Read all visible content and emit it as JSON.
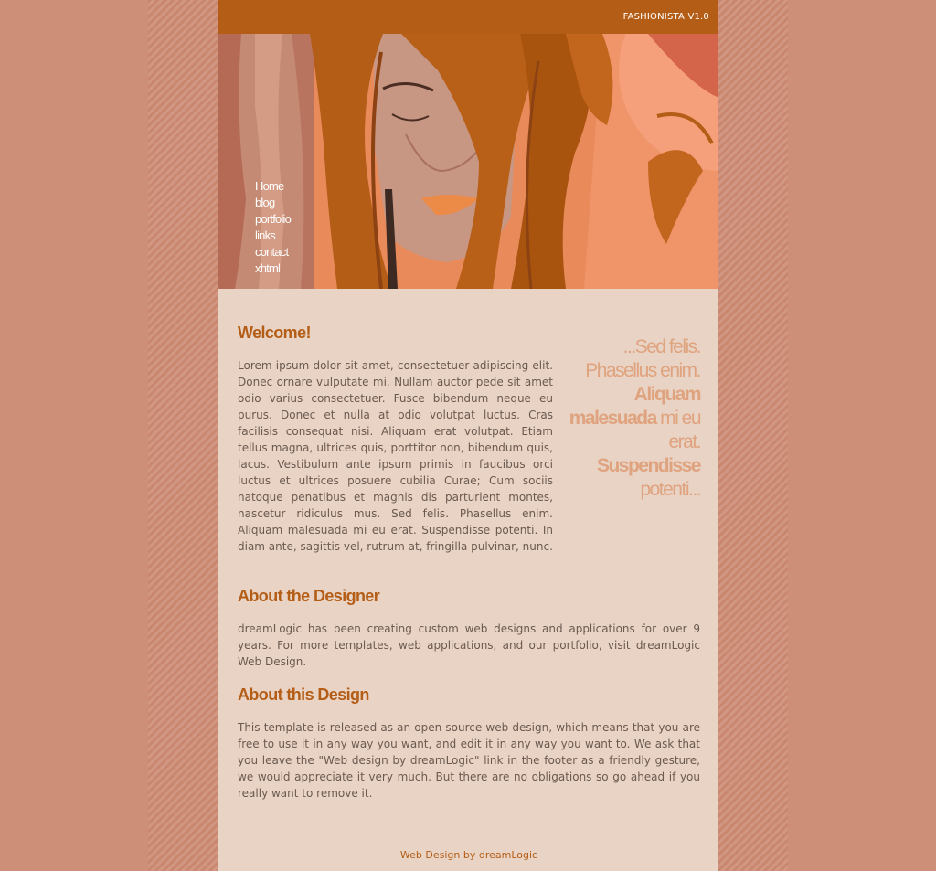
{
  "site": {
    "title": "FASHIONISTA V1.0"
  },
  "nav": {
    "items": [
      "Home",
      "blog",
      "portfolio",
      "links",
      "contact",
      "xhtml"
    ]
  },
  "welcome": {
    "heading": "Welcome!",
    "body": "Lorem ipsum dolor sit amet, consectetuer adipiscing elit. Donec ornare vulputate mi. Nullam auctor pede sit amet odio varius consectetuer. Fusce bibendum neque eu purus. Donec et nulla at odio volutpat luctus. Cras facilisis consequat nisi. Aliquam erat volutpat. Etiam tellus magna, ultrices quis, porttitor non, bibendum quis, lacus. Vestibulum ante ipsum primis in faucibus orci luctus et ultrices posuere cubilia Curae; Cum sociis natoque penatibus et magnis dis parturient montes, nascetur ridiculus mus. Sed felis. Phasellus enim. Aliquam malesuada mi eu erat. Suspendisse potenti. In diam ante, sagittis vel, rutrum at, fringilla pulvinar, nunc."
  },
  "pullquote": {
    "part1": "...Sed felis. Phasellus enim. ",
    "bold1": "Aliquam malesuada",
    "part2": " mi eu erat. ",
    "bold2": "Suspendisse",
    "part3": " potenti..."
  },
  "designer": {
    "heading": "About the Designer",
    "body": "dreamLogic has been creating custom web designs and applications for over 9 years. For more templates, web applications, and our portfolio, visit dreamLogic Web Design."
  },
  "design": {
    "heading": "About this Design",
    "body": "This template is released as an open source web design, which means that you are free to use it in any way you want, and edit it in any way you want to. We ask that you leave the \"Web design by dreamLogic\" link in the footer as a friendly gesture, we would appreciate it very much. But there are no obligations so go ahead if you really want to remove it."
  },
  "footer": {
    "text": "Web Design by dreamLogic"
  },
  "colors": {
    "background": "#cd8f78",
    "page": "#e8d3c4",
    "accent": "#b45d16",
    "quote": "#e0a37f",
    "text": "#6b5a50"
  }
}
